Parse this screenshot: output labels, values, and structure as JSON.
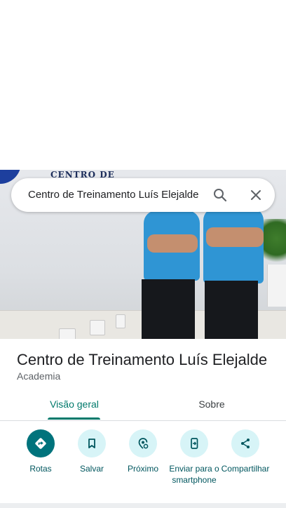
{
  "search": {
    "query": "Centro de Treinamento Luís Elejalde"
  },
  "photo": {
    "wall_text": "CENTRO DE TREINAMENTO"
  },
  "place": {
    "title": "Centro de Treinamento Luís Elejalde",
    "category": "Academia"
  },
  "tabs": [
    {
      "label": "Visão geral",
      "selected": true
    },
    {
      "label": "Sobre",
      "selected": false
    }
  ],
  "actions": [
    {
      "label": "Rotas",
      "icon": "directions-icon"
    },
    {
      "label": "Salvar",
      "icon": "bookmark-icon"
    },
    {
      "label": "Próximo",
      "icon": "nearby-icon"
    },
    {
      "label": "Enviar para o smartphone",
      "icon": "send-to-phone-icon"
    },
    {
      "label": "Compartilhar",
      "icon": "share-icon"
    }
  ],
  "colors": {
    "accent": "#00796b",
    "action_bg": "#d7f4f7",
    "primary_action_bg": "#00737c",
    "action_label": "#00565e"
  }
}
